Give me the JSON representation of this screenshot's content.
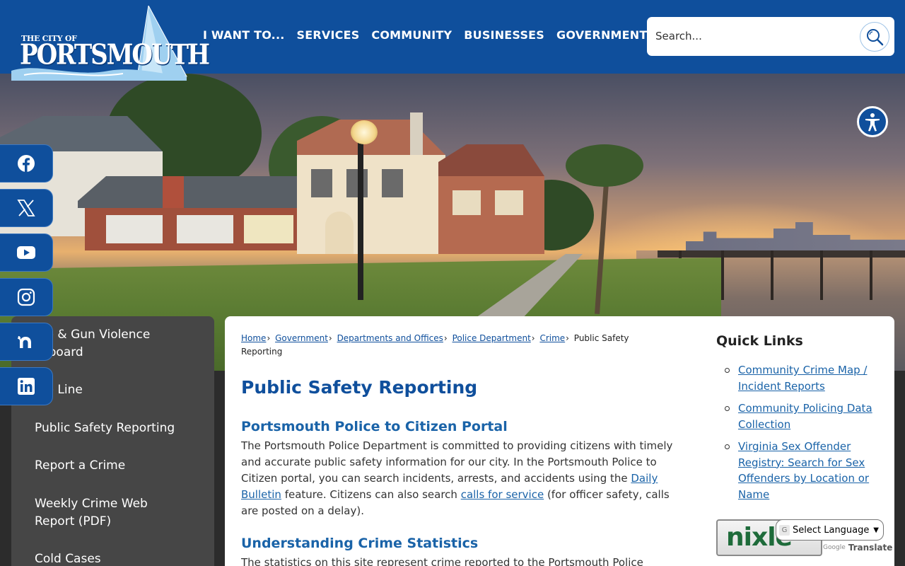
{
  "header": {
    "logo": {
      "small_text": "THE CITY OF",
      "big_text": "PORTSMOUTH"
    },
    "nav": [
      "I WANT TO...",
      "SERVICES",
      "COMMUNITY",
      "BUSINESSES",
      "GOVERNMENT"
    ],
    "search": {
      "placeholder": "Search...",
      "icon": "search-icon"
    }
  },
  "accessibility": {
    "icon": "accessibility-icon"
  },
  "social": [
    {
      "icon": "facebook-icon"
    },
    {
      "icon": "x-twitter-icon"
    },
    {
      "icon": "youtube-icon"
    },
    {
      "icon": "instagram-icon"
    },
    {
      "icon": "nextdoor-icon"
    },
    {
      "icon": "linkedin-icon"
    }
  ],
  "sidebar": {
    "items": [
      {
        "label": "me & Gun Violence\nshboard"
      },
      {
        "label": "me Line"
      },
      {
        "label": "Public Safety Reporting"
      },
      {
        "label": "Report a Crime"
      },
      {
        "label": "Weekly Crime Web\nReport (PDF)"
      },
      {
        "label": "Cold Cases"
      }
    ]
  },
  "breadcrumb": {
    "items": [
      "Home",
      " Government",
      " Departments and Offices",
      " Police Department",
      " Crime"
    ],
    "current": "Public Safety\nReporting",
    "separator": "›"
  },
  "main": {
    "title": "Public Safety Reporting",
    "section1": {
      "heading": "Portsmouth Police to Citizen Portal",
      "text_a": "The Portsmouth Police Department is committed to providing citizens with timely and accurate public safety information for our city. In the Portsmouth Police to Citizen portal, you can search incidents, arrests, and accidents using the ",
      "link_a": "Daily Bulletin",
      "text_b": " feature. Citizens can also search ",
      "link_b": "calls for service",
      "text_c": " (for officer safety, calls are posted on a delay)."
    },
    "section2": {
      "heading": "Understanding Crime Statistics",
      "text": "The statistics on this site represent crime reported to the Portsmouth Police"
    }
  },
  "quick_links": {
    "title": "Quick Links",
    "items": [
      "Community Crime Map / Incident Reports",
      "Community Policing Data Collection",
      "Virginia Sex Offender Registry: Search for Sex Offenders by Location or Name"
    ]
  },
  "nixle": {
    "label": "nixle"
  },
  "translate": {
    "select_label": "Select Language",
    "powered_by": "Google",
    "translate_label": "Translate"
  },
  "colors": {
    "brand_blue": "#0f4f9c",
    "link_blue": "#1a63a8",
    "sidebar_bg": "#464646"
  }
}
